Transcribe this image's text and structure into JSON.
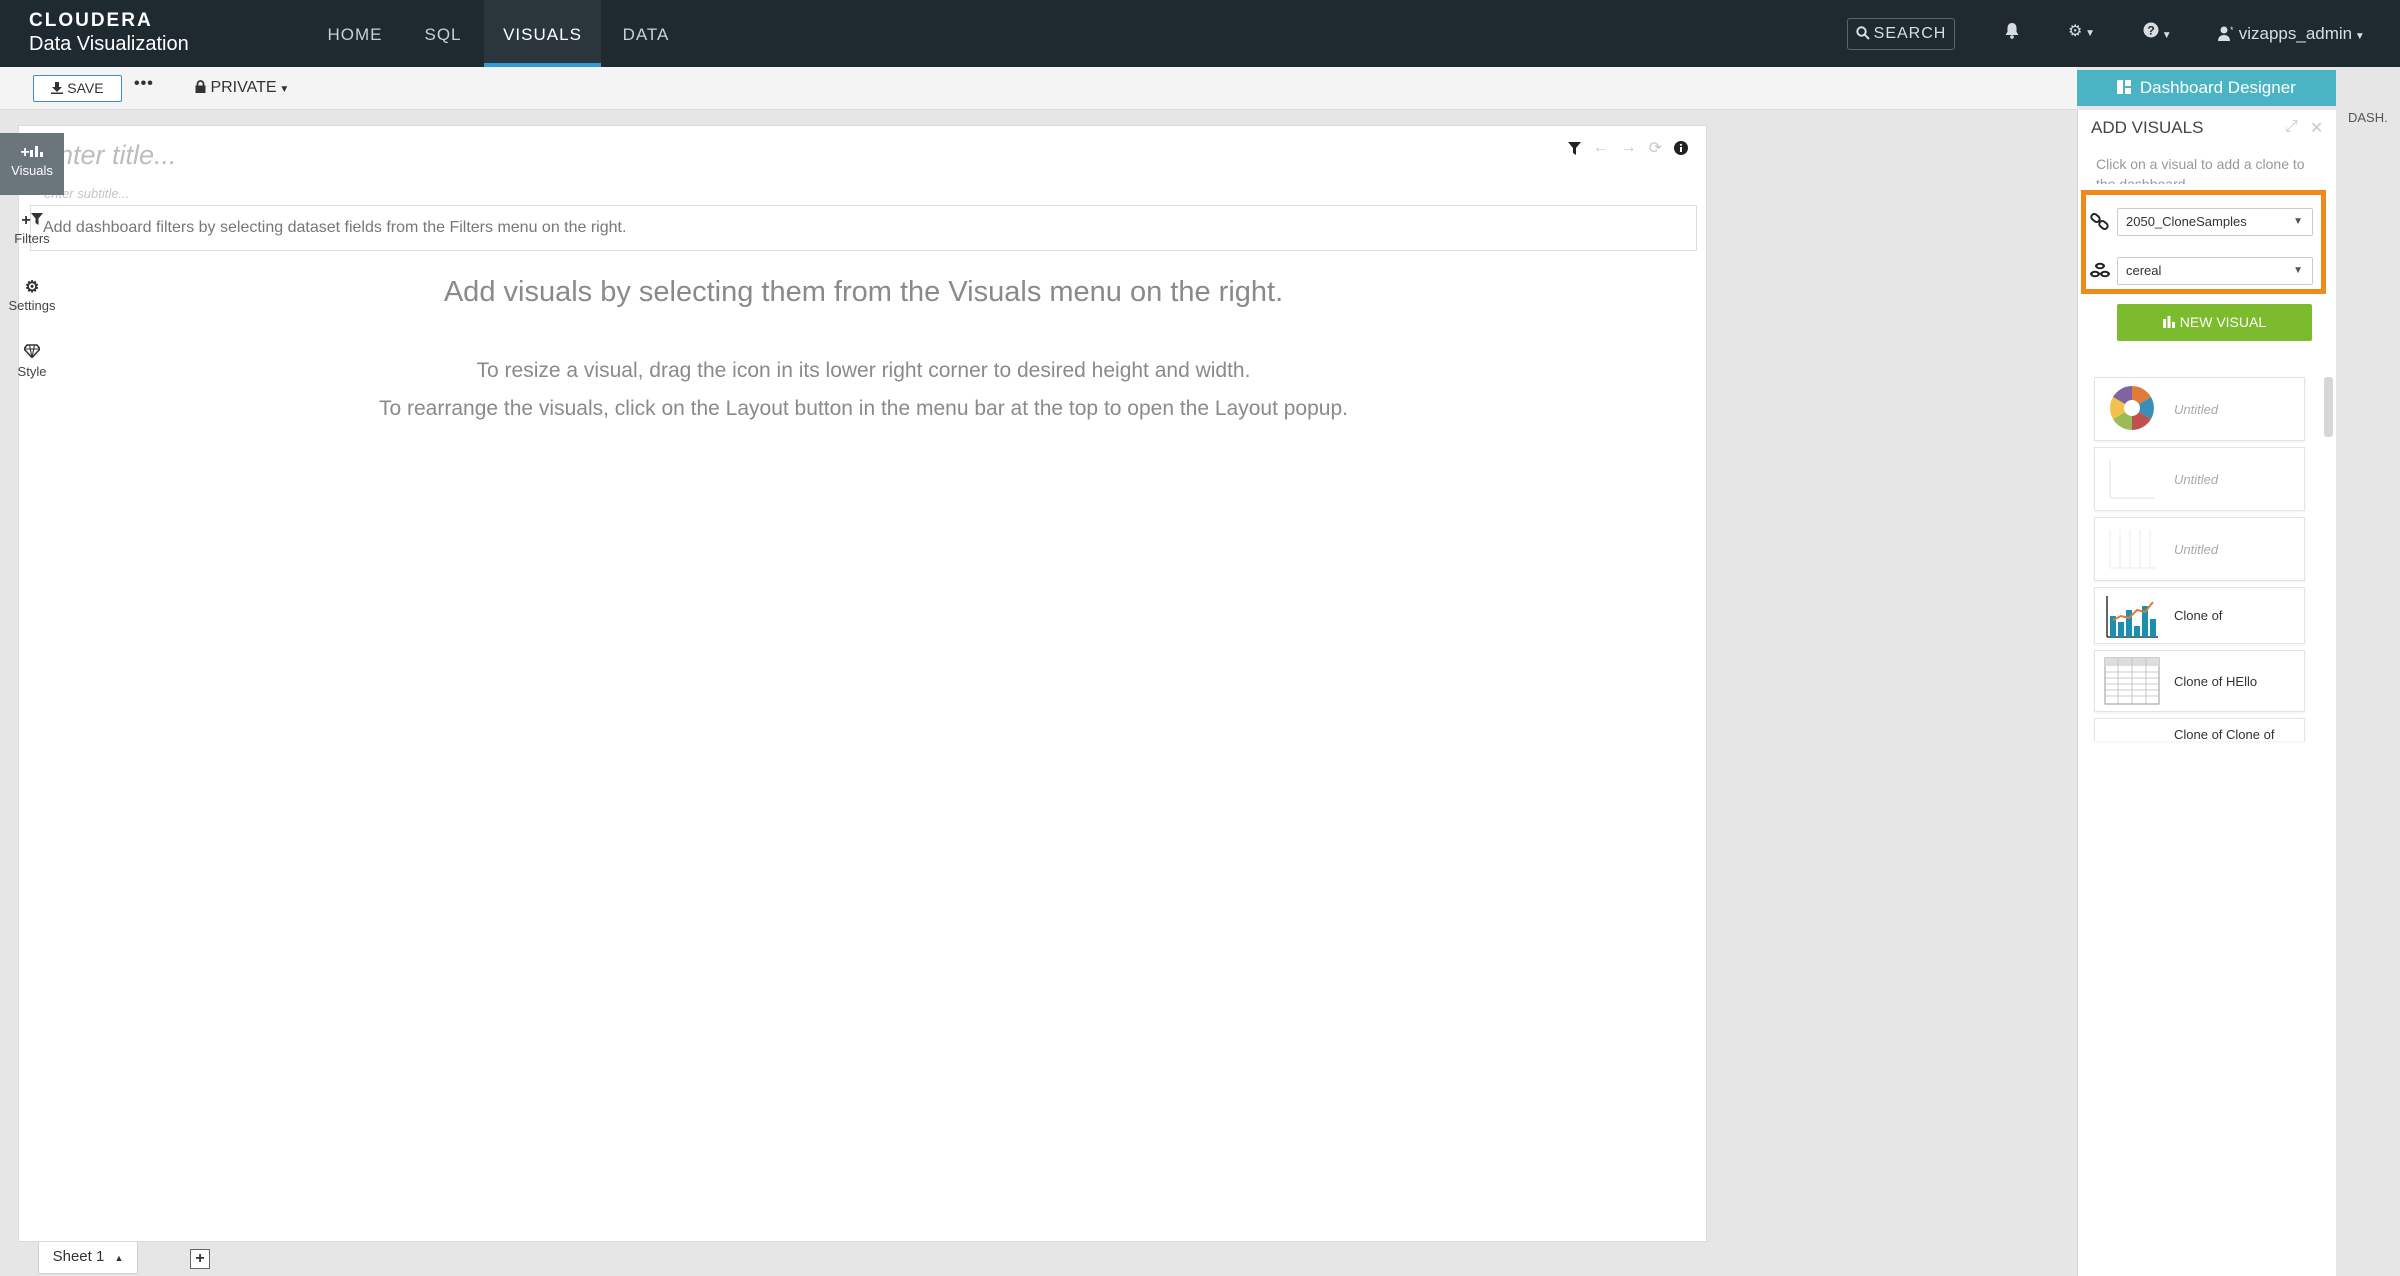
{
  "brand": {
    "line1": "CLOUDERA",
    "line2": "Data Visualization"
  },
  "nav": {
    "tabs": [
      {
        "label": "HOME"
      },
      {
        "label": "SQL"
      },
      {
        "label": "VISUALS"
      },
      {
        "label": "DATA"
      }
    ],
    "active_tab": "VISUALS",
    "search_label": "SEARCH",
    "user_label": "vizapps_admin"
  },
  "toolbar": {
    "save_label": "SAVE",
    "more_label": "•••",
    "private_label": "PRIVATE"
  },
  "canvas": {
    "title_placeholder": "enter title...",
    "subtitle_placeholder": "enter subtitle...",
    "filters_hint": "Add dashboard filters by selecting dataset fields from the Filters menu on the right.",
    "main_message": "Add visuals by selecting them from the Visuals menu on the right.",
    "resize_hint": "To resize a visual, drag the icon in its lower right corner to desired height and width.",
    "rearrange_hint": "To rearrange the visuals, click on the Layout button in the menu bar at the top to open the Layout popup."
  },
  "sheets": {
    "tabs": [
      {
        "label": "Sheet 1"
      }
    ],
    "add_label": "+"
  },
  "designer": {
    "button_label": "Dashboard Designer",
    "dash_label": "DASH.",
    "panel_title": "ADD VISUALS",
    "hint": "Click on a visual to add a clone to the dashboard",
    "connection_value": "2050_CloneSamples",
    "dataset_value": "cereal",
    "new_visual_label": "NEW VISUAL",
    "visuals": [
      {
        "label": "Untitled",
        "thumb": "pie-chart-icon",
        "untitled": true
      },
      {
        "label": "Untitled",
        "thumb": "blank-chart-icon",
        "untitled": true
      },
      {
        "label": "Untitled",
        "thumb": "grid-chart-icon",
        "untitled": true
      },
      {
        "label": "Clone of",
        "thumb": "bar-line-chart-icon",
        "untitled": false
      },
      {
        "label": "Clone of HEllo",
        "thumb": "table-icon",
        "untitled": false
      },
      {
        "label": "Clone of Clone of",
        "thumb": "blank-chart-icon",
        "untitled": false
      }
    ]
  },
  "side_tabs": [
    {
      "label": "Visuals",
      "icon": "add-visual-icon"
    },
    {
      "label": "Filters",
      "icon": "add-filter-icon"
    },
    {
      "label": "Settings",
      "icon": "settings-gears-icon"
    },
    {
      "label": "Style",
      "icon": "diamond-icon"
    }
  ],
  "colors": {
    "accent": "#4ab3c4",
    "highlight": "#f08a1d",
    "new_visual": "#7cba2e",
    "nav_bg": "#1f2a30"
  }
}
